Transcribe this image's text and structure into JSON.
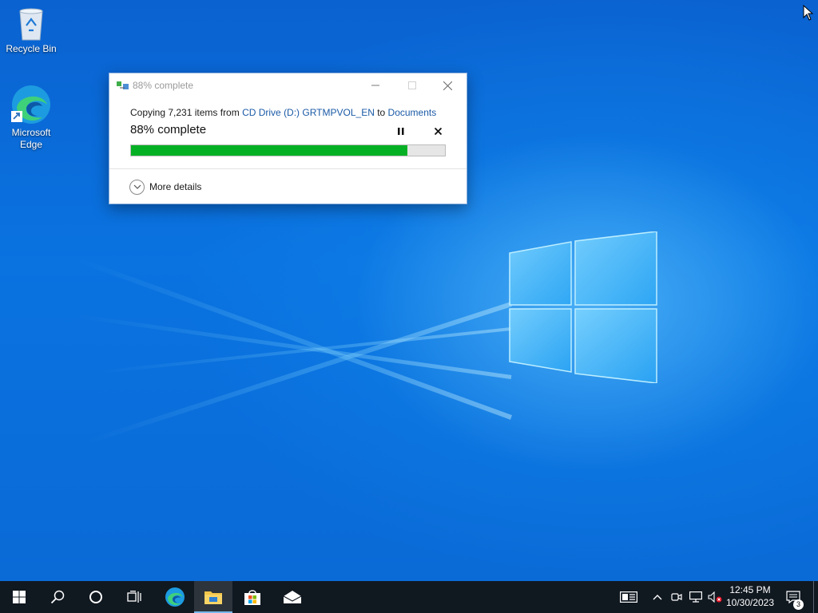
{
  "desktop": {
    "icons": [
      {
        "label": "Recycle Bin",
        "icon": "recycle-bin-icon"
      },
      {
        "label": "Microsoft Edge",
        "icon": "edge-icon"
      }
    ]
  },
  "dialog": {
    "title": "88% complete",
    "line1_prefix": "Copying 7,231 items from ",
    "source": "CD Drive (D:) GRTMPVOL_EN",
    "line1_mid": " to ",
    "destination": "Documents",
    "percent_label": "88% complete",
    "progress": 0.88,
    "more_details": "More details",
    "progress_color": "#06b025"
  },
  "taskbar": {
    "apps": [
      "start-icon",
      "search-icon",
      "cortana-icon",
      "task-view-icon",
      "edge-icon",
      "file-explorer-icon",
      "store-icon",
      "mail-icon"
    ],
    "time": "12:45 PM",
    "date": "10/30/2023",
    "notifications_count": "3"
  }
}
